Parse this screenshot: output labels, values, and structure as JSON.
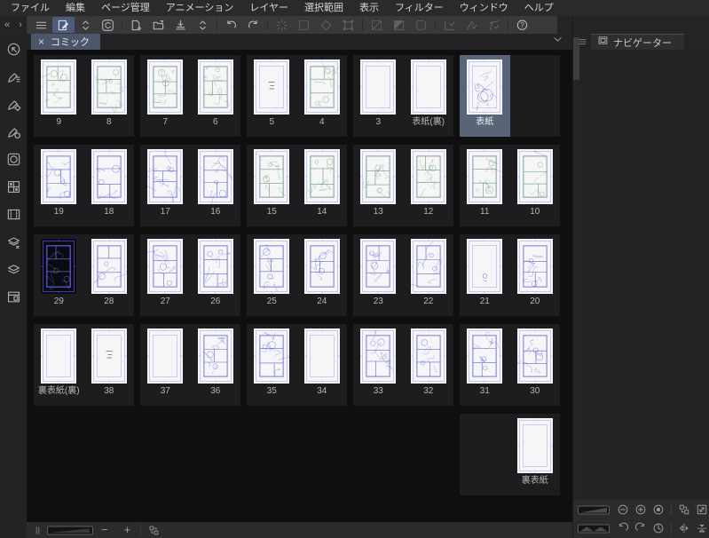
{
  "app": {
    "colors": {
      "selection": "#5a6478",
      "ink_green": "#5f935f",
      "ink_blue": "#5353c6",
      "ink_current": "#8a8aee",
      "guide": "#b9bce6",
      "current_guide": "#4848d8",
      "active_tool_bg": "#4d5c7c"
    }
  },
  "menu_bar": {
    "items": [
      "ファイル",
      "編集",
      "ページ管理",
      "アニメーション",
      "レイヤー",
      "選択範囲",
      "表示",
      "フィルター",
      "ウィンドウ",
      "ヘルプ"
    ]
  },
  "toolbar": {
    "collapse_arrows": [
      "«",
      "›"
    ],
    "panel_arrows": [
      "›",
      "»"
    ],
    "items": [
      {
        "name": "main-menu-icon",
        "state": "normal"
      },
      {
        "name": "page-edit-tool-icon",
        "state": "active"
      },
      {
        "name": "updown-chevrons-icon",
        "state": "normal"
      },
      {
        "name": "clip-studio-logo-icon",
        "state": "normal"
      },
      {
        "sep": true
      },
      {
        "name": "new-file-icon",
        "state": "normal"
      },
      {
        "name": "open-file-icon",
        "state": "normal"
      },
      {
        "name": "save-file-icon",
        "state": "normal"
      },
      {
        "name": "updown-chevrons-icon",
        "state": "normal"
      },
      {
        "sep": true
      },
      {
        "name": "undo-icon",
        "state": "normal"
      },
      {
        "name": "redo-icon",
        "state": "normal"
      },
      {
        "sep": true
      },
      {
        "name": "spinner-icon",
        "state": "disabled"
      },
      {
        "name": "marquee-select-icon",
        "state": "disabled"
      },
      {
        "name": "lasso-select-icon",
        "state": "disabled"
      },
      {
        "name": "transform-icon",
        "state": "disabled"
      },
      {
        "sep": true
      },
      {
        "name": "deselect-icon",
        "state": "disabled"
      },
      {
        "name": "invert-selection-icon",
        "state": "disabled"
      },
      {
        "name": "selection-border-icon",
        "state": "disabled"
      },
      {
        "sep": true
      },
      {
        "name": "snap-ruler-icon",
        "state": "disabled"
      },
      {
        "name": "snap-special-ruler-icon",
        "state": "disabled"
      },
      {
        "name": "snap-grid-icon",
        "state": "disabled"
      },
      {
        "sep": true
      },
      {
        "name": "help-icon",
        "state": "normal"
      }
    ]
  },
  "canvas_tab_bar": {
    "active_tab": {
      "label": "コミック",
      "close_glyph": "×"
    },
    "overflow_icon": "chevron-down-icon"
  },
  "left_palette": {
    "icons": [
      {
        "name": "quick-access-icon"
      },
      {
        "name": "subtool-icon"
      },
      {
        "name": "tool-property-icon"
      },
      {
        "name": "brush-size-icon"
      },
      {
        "name": "color-wheel-icon"
      },
      {
        "name": "color-set-icon"
      },
      {
        "name": "material-icon"
      },
      {
        "name": "layer-property-icon"
      },
      {
        "name": "layers-icon"
      },
      {
        "name": "information-icon"
      }
    ]
  },
  "page_manager": {
    "rows": [
      {
        "containers": [
          {
            "pages": [
              {
                "label": "9",
                "ink": "green",
                "style": "panels"
              },
              {
                "label": "8",
                "ink": "green",
                "style": "panels"
              }
            ]
          },
          {
            "pages": [
              {
                "label": "7",
                "ink": "green",
                "style": "panels"
              },
              {
                "label": "6",
                "ink": "green",
                "style": "panels"
              }
            ]
          },
          {
            "pages": [
              {
                "label": "5",
                "ink": "none",
                "style": "text"
              },
              {
                "label": "4",
                "ink": "green",
                "style": "panels"
              }
            ]
          },
          {
            "pages": [
              {
                "label": "3",
                "ink": "none",
                "style": "blank"
              },
              {
                "label": "表紙(裏)",
                "ink": "none",
                "style": "blank"
              }
            ]
          },
          {
            "side": "left",
            "pages": [
              {
                "label": "表紙",
                "ink": "blue",
                "style": "cover",
                "selected": true
              }
            ]
          }
        ]
      },
      {
        "containers": [
          {
            "pages": [
              {
                "label": "19",
                "ink": "blue",
                "style": "panels"
              },
              {
                "label": "18",
                "ink": "blue",
                "style": "panels",
                "density": "sparse"
              }
            ]
          },
          {
            "pages": [
              {
                "label": "17",
                "ink": "blue",
                "style": "panels"
              },
              {
                "label": "16",
                "ink": "blue",
                "style": "panels"
              }
            ]
          },
          {
            "pages": [
              {
                "label": "15",
                "ink": "green",
                "style": "panels"
              },
              {
                "label": "14",
                "ink": "green",
                "style": "panels"
              }
            ]
          },
          {
            "pages": [
              {
                "label": "13",
                "ink": "green",
                "style": "panels"
              },
              {
                "label": "12",
                "ink": "green",
                "style": "panels"
              }
            ]
          },
          {
            "pages": [
              {
                "label": "11",
                "ink": "green",
                "style": "panels"
              },
              {
                "label": "10",
                "ink": "green",
                "style": "panels",
                "density": "sparse"
              }
            ]
          }
        ]
      },
      {
        "containers": [
          {
            "pages": [
              {
                "label": "29",
                "ink": "blue",
                "style": "panels",
                "current": true
              },
              {
                "label": "28",
                "ink": "blue",
                "style": "panels",
                "density": "sparse"
              }
            ]
          },
          {
            "pages": [
              {
                "label": "27",
                "ink": "blue",
                "style": "panels"
              },
              {
                "label": "26",
                "ink": "blue",
                "style": "panels"
              }
            ]
          },
          {
            "pages": [
              {
                "label": "25",
                "ink": "blue",
                "style": "panels"
              },
              {
                "label": "24",
                "ink": "blue",
                "style": "panels"
              }
            ]
          },
          {
            "pages": [
              {
                "label": "23",
                "ink": "blue",
                "style": "panels"
              },
              {
                "label": "22",
                "ink": "blue",
                "style": "panels"
              }
            ]
          },
          {
            "pages": [
              {
                "label": "21",
                "ink": "blue",
                "style": "spot"
              },
              {
                "label": "20",
                "ink": "blue",
                "style": "panels"
              }
            ]
          }
        ]
      },
      {
        "containers": [
          {
            "pages": [
              {
                "label": "裏表紙(裏)",
                "ink": "none",
                "style": "blank"
              },
              {
                "label": "38",
                "ink": "none",
                "style": "text"
              }
            ]
          },
          {
            "pages": [
              {
                "label": "37",
                "ink": "none",
                "style": "blank"
              },
              {
                "label": "36",
                "ink": "blue",
                "style": "panels"
              }
            ]
          },
          {
            "pages": [
              {
                "label": "35",
                "ink": "blue",
                "style": "panels"
              },
              {
                "label": "34",
                "ink": "none",
                "style": "blank"
              }
            ]
          },
          {
            "pages": [
              {
                "label": "33",
                "ink": "blue",
                "style": "panels"
              },
              {
                "label": "32",
                "ink": "blue",
                "style": "panels",
                "density": "sparse"
              }
            ]
          },
          {
            "pages": [
              {
                "label": "31",
                "ink": "blue",
                "style": "panels"
              },
              {
                "label": "30",
                "ink": "blue",
                "style": "panels"
              }
            ]
          }
        ]
      },
      {
        "containers": [
          {
            "offset": 4,
            "side": "right",
            "pages": [
              {
                "label": "裏表紙",
                "ink": "none",
                "style": "blank"
              }
            ]
          }
        ]
      }
    ]
  },
  "status_bar": {
    "zoom_out_label": "−",
    "zoom_in_label": "+",
    "icons": [
      {
        "name": "grip-icon"
      },
      {
        "name": "thumbnail-size-slider"
      },
      {
        "name": "pages-icon"
      }
    ]
  },
  "navigator_panel": {
    "menu_icon": "hamburger-icon",
    "tab": {
      "label": "ナビゲーター",
      "icon": "navigator-tab-icon"
    },
    "controls": {
      "row1": [
        {
          "name": "zoom-slider",
          "type": "slider-zoom"
        },
        {
          "name": "zoom-out-button",
          "icon": "minus-circle"
        },
        {
          "name": "zoom-in-button",
          "icon": "plus-circle"
        },
        {
          "name": "actual-size-button",
          "icon": "actual-size"
        },
        {
          "sep": true
        },
        {
          "name": "fit-to-screen-button",
          "icon": "fit-screen"
        },
        {
          "name": "fit-window-button",
          "icon": "fit-window"
        }
      ],
      "row2": [
        {
          "name": "rotate-slider",
          "type": "slider-rotate"
        },
        {
          "name": "rotate-left-button",
          "icon": "rotate-ccw"
        },
        {
          "name": "rotate-right-button",
          "icon": "rotate-cw"
        },
        {
          "name": "reset-rotation-button",
          "icon": "reset-rotation"
        },
        {
          "sep": true
        },
        {
          "name": "flip-horizontal-button",
          "icon": "flip-h"
        },
        {
          "name": "flip-vertical-button",
          "icon": "flip-v"
        }
      ]
    }
  }
}
